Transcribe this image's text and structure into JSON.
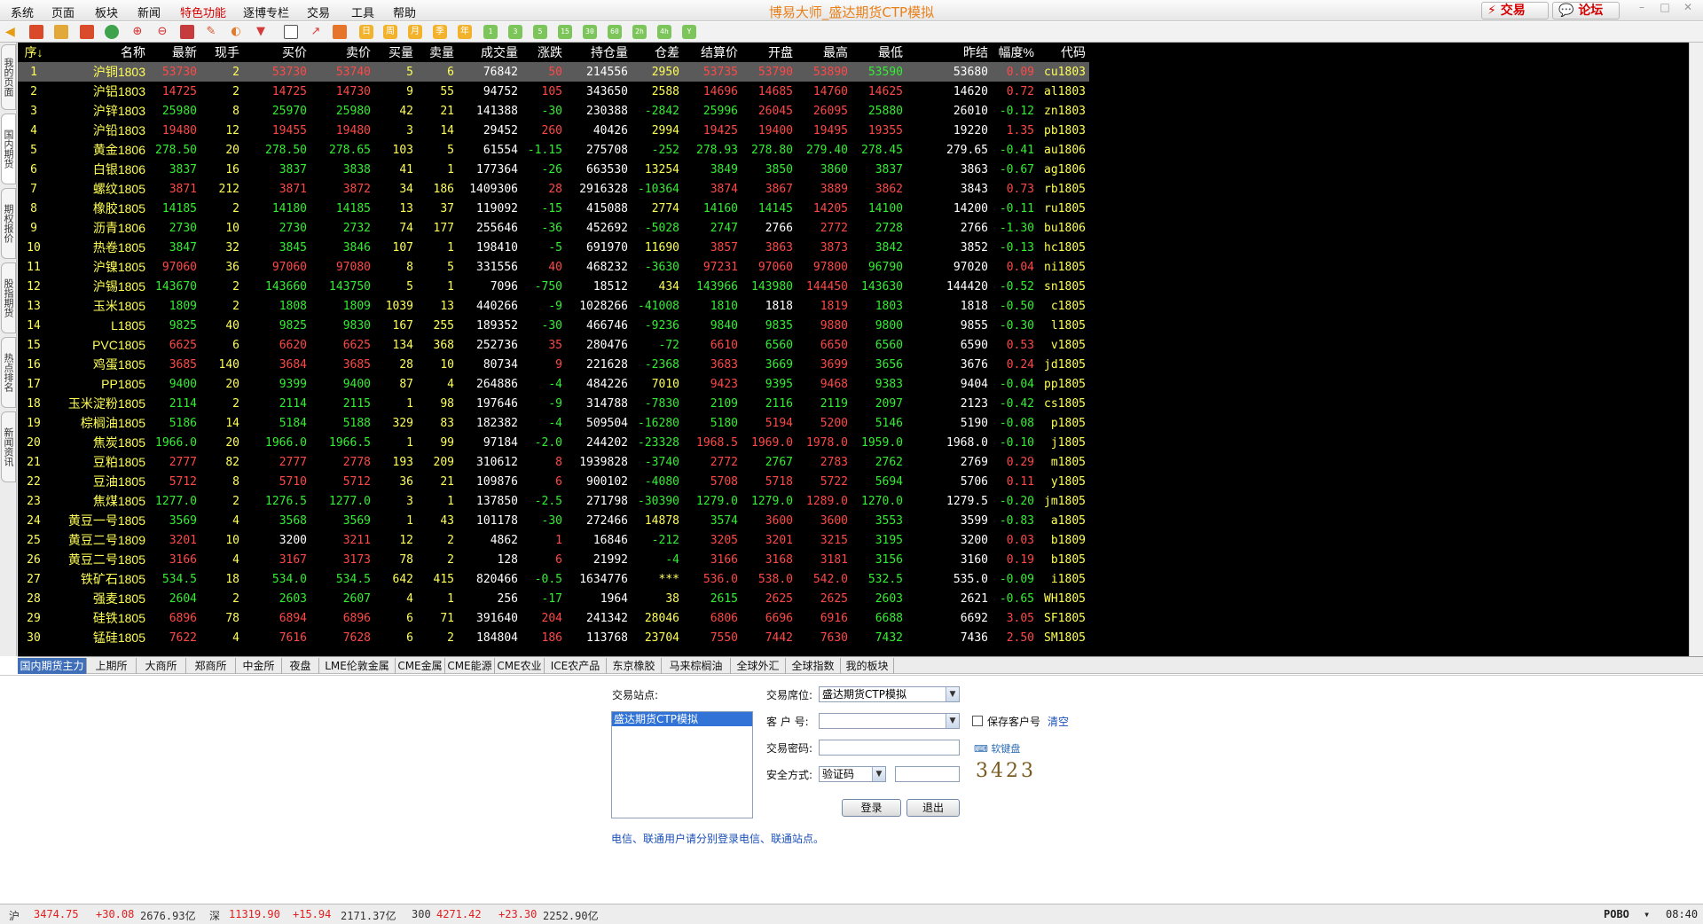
{
  "menu": [
    "系统",
    "页面",
    "板块",
    "新闻",
    "特色功能",
    "逐博专栏",
    "交易",
    "工具",
    "帮助"
  ],
  "app_title": "博易大师_盛达期货CTP模拟",
  "header_buttons": {
    "trade": "交易",
    "forum": "论坛"
  },
  "toolbar": {
    "period_labels": [
      "日",
      "周",
      "月",
      "季",
      "年"
    ],
    "minute_labels": [
      "1",
      "3",
      "5",
      "15",
      "30",
      "60",
      "2h",
      "4h"
    ]
  },
  "left_tabs": [
    "我的页面",
    "国内期货",
    "期权报价",
    "股指期货",
    "热点排名",
    "新闻资讯"
  ],
  "table": {
    "columns": [
      "序↓",
      "名称",
      "最新",
      "现手",
      "买价",
      "卖价",
      "买量",
      "卖量",
      "成交量",
      "涨跌",
      "持仓量",
      "仓差",
      "结算价",
      "开盘",
      "最高",
      "最低",
      "昨结",
      "幅度%",
      "代码"
    ],
    "rows": [
      [
        "1",
        "沪铜1803",
        "53730",
        "2",
        "53730",
        "53740",
        "5",
        "6",
        "76842",
        "50",
        "214556",
        "2950",
        "53735",
        "53790",
        "53890",
        "53590",
        "53680",
        "0.09",
        "cu1803"
      ],
      [
        "2",
        "沪铝1803",
        "14725",
        "2",
        "14725",
        "14730",
        "9",
        "55",
        "94752",
        "105",
        "343650",
        "2588",
        "14696",
        "14685",
        "14760",
        "14625",
        "14620",
        "0.72",
        "al1803"
      ],
      [
        "3",
        "沪锌1803",
        "25980",
        "8",
        "25970",
        "25980",
        "42",
        "21",
        "141388",
        "-30",
        "230388",
        "-2842",
        "25996",
        "26045",
        "26095",
        "25880",
        "26010",
        "-0.12",
        "zn1803"
      ],
      [
        "4",
        "沪铅1803",
        "19480",
        "12",
        "19455",
        "19480",
        "3",
        "14",
        "29452",
        "260",
        "40426",
        "2994",
        "19425",
        "19400",
        "19495",
        "19355",
        "19220",
        "1.35",
        "pb1803"
      ],
      [
        "5",
        "黄金1806",
        "278.50",
        "20",
        "278.50",
        "278.65",
        "103",
        "5",
        "61554",
        "-1.15",
        "275708",
        "-252",
        "278.93",
        "278.80",
        "279.40",
        "278.45",
        "279.65",
        "-0.41",
        "au1806"
      ],
      [
        "6",
        "白银1806",
        "3837",
        "16",
        "3837",
        "3838",
        "41",
        "1",
        "177364",
        "-26",
        "663530",
        "13254",
        "3849",
        "3850",
        "3860",
        "3837",
        "3863",
        "-0.67",
        "ag1806"
      ],
      [
        "7",
        "螺纹1805",
        "3871",
        "212",
        "3871",
        "3872",
        "34",
        "186",
        "1409306",
        "28",
        "2916328",
        "-10364",
        "3874",
        "3867",
        "3889",
        "3862",
        "3843",
        "0.73",
        "rb1805"
      ],
      [
        "8",
        "橡胶1805",
        "14185",
        "2",
        "14180",
        "14185",
        "13",
        "37",
        "119092",
        "-15",
        "415088",
        "2774",
        "14160",
        "14145",
        "14205",
        "14100",
        "14200",
        "-0.11",
        "ru1805"
      ],
      [
        "9",
        "沥青1806",
        "2730",
        "10",
        "2730",
        "2732",
        "74",
        "177",
        "255646",
        "-36",
        "452692",
        "-5028",
        "2747",
        "2766",
        "2772",
        "2728",
        "2766",
        "-1.30",
        "bu1806"
      ],
      [
        "10",
        "热卷1805",
        "3847",
        "32",
        "3845",
        "3846",
        "107",
        "1",
        "198410",
        "-5",
        "691970",
        "11690",
        "3857",
        "3863",
        "3873",
        "3842",
        "3852",
        "-0.13",
        "hc1805"
      ],
      [
        "11",
        "沪镍1805",
        "97060",
        "36",
        "97060",
        "97080",
        "8",
        "5",
        "331556",
        "40",
        "468232",
        "-3630",
        "97231",
        "97060",
        "97800",
        "96790",
        "97020",
        "0.04",
        "ni1805"
      ],
      [
        "12",
        "沪锡1805",
        "143670",
        "2",
        "143660",
        "143750",
        "5",
        "1",
        "7096",
        "-750",
        "18512",
        "434",
        "143966",
        "143980",
        "144450",
        "143630",
        "144420",
        "-0.52",
        "sn1805"
      ],
      [
        "13",
        "玉米1805",
        "1809",
        "2",
        "1808",
        "1809",
        "1039",
        "13",
        "440266",
        "-9",
        "1028266",
        "-41008",
        "1810",
        "1818",
        "1819",
        "1803",
        "1818",
        "-0.50",
        "c1805"
      ],
      [
        "14",
        "L1805",
        "9825",
        "40",
        "9825",
        "9830",
        "167",
        "255",
        "189352",
        "-30",
        "466746",
        "-9236",
        "9840",
        "9835",
        "9880",
        "9800",
        "9855",
        "-0.30",
        "l1805"
      ],
      [
        "15",
        "PVC1805",
        "6625",
        "6",
        "6620",
        "6625",
        "134",
        "368",
        "252736",
        "35",
        "280476",
        "-72",
        "6610",
        "6560",
        "6650",
        "6560",
        "6590",
        "0.53",
        "v1805"
      ],
      [
        "16",
        "鸡蛋1805",
        "3685",
        "140",
        "3684",
        "3685",
        "28",
        "10",
        "80734",
        "9",
        "221628",
        "-2368",
        "3683",
        "3669",
        "3699",
        "3656",
        "3676",
        "0.24",
        "jd1805"
      ],
      [
        "17",
        "PP1805",
        "9400",
        "20",
        "9399",
        "9400",
        "87",
        "4",
        "264886",
        "-4",
        "484226",
        "7010",
        "9423",
        "9395",
        "9468",
        "9383",
        "9404",
        "-0.04",
        "pp1805"
      ],
      [
        "18",
        "玉米淀粉1805",
        "2114",
        "2",
        "2114",
        "2115",
        "1",
        "98",
        "197646",
        "-9",
        "314788",
        "-7830",
        "2109",
        "2116",
        "2119",
        "2097",
        "2123",
        "-0.42",
        "cs1805"
      ],
      [
        "19",
        "棕榈油1805",
        "5186",
        "14",
        "5184",
        "5188",
        "329",
        "83",
        "182382",
        "-4",
        "509504",
        "-16280",
        "5180",
        "5194",
        "5200",
        "5146",
        "5190",
        "-0.08",
        "p1805"
      ],
      [
        "20",
        "焦炭1805",
        "1966.0",
        "20",
        "1966.0",
        "1966.5",
        "1",
        "99",
        "97184",
        "-2.0",
        "244202",
        "-23328",
        "1968.5",
        "1969.0",
        "1978.0",
        "1959.0",
        "1968.0",
        "-0.10",
        "j1805"
      ],
      [
        "21",
        "豆粕1805",
        "2777",
        "82",
        "2777",
        "2778",
        "193",
        "209",
        "310612",
        "8",
        "1939828",
        "-3740",
        "2772",
        "2767",
        "2783",
        "2762",
        "2769",
        "0.29",
        "m1805"
      ],
      [
        "22",
        "豆油1805",
        "5712",
        "8",
        "5710",
        "5712",
        "36",
        "21",
        "109876",
        "6",
        "900102",
        "-4080",
        "5708",
        "5718",
        "5722",
        "5694",
        "5706",
        "0.11",
        "y1805"
      ],
      [
        "23",
        "焦煤1805",
        "1277.0",
        "2",
        "1276.5",
        "1277.0",
        "3",
        "1",
        "137850",
        "-2.5",
        "271798",
        "-30390",
        "1279.0",
        "1279.0",
        "1289.0",
        "1270.0",
        "1279.5",
        "-0.20",
        "jm1805"
      ],
      [
        "24",
        "黄豆一号1805",
        "3569",
        "4",
        "3568",
        "3569",
        "1",
        "43",
        "101178",
        "-30",
        "272466",
        "14878",
        "3574",
        "3600",
        "3600",
        "3553",
        "3599",
        "-0.83",
        "a1805"
      ],
      [
        "25",
        "黄豆二号1809",
        "3201",
        "10",
        "3200",
        "3211",
        "12",
        "2",
        "4862",
        "1",
        "16846",
        "-212",
        "3205",
        "3201",
        "3215",
        "3195",
        "3200",
        "0.03",
        "b1809"
      ],
      [
        "26",
        "黄豆二号1805",
        "3166",
        "4",
        "3167",
        "3173",
        "78",
        "2",
        "128",
        "6",
        "21992",
        "-4",
        "3166",
        "3168",
        "3181",
        "3156",
        "3160",
        "0.19",
        "b1805"
      ],
      [
        "27",
        "铁矿石1805",
        "534.5",
        "18",
        "534.0",
        "534.5",
        "642",
        "415",
        "820466",
        "-0.5",
        "1634776",
        "***",
        "536.0",
        "538.0",
        "542.0",
        "532.5",
        "535.0",
        "-0.09",
        "i1805"
      ],
      [
        "28",
        "强麦1805",
        "2604",
        "2",
        "2603",
        "2607",
        "4",
        "1",
        "256",
        "-17",
        "1964",
        "38",
        "2615",
        "2625",
        "2625",
        "2603",
        "2621",
        "-0.65",
        "WH1805"
      ],
      [
        "29",
        "硅铁1805",
        "6896",
        "78",
        "6894",
        "6896",
        "6",
        "71",
        "391640",
        "204",
        "241342",
        "28046",
        "6806",
        "6696",
        "6916",
        "6688",
        "6692",
        "3.05",
        "SF1805"
      ],
      [
        "30",
        "锰硅1805",
        "7622",
        "4",
        "7616",
        "7628",
        "6",
        "2",
        "184804",
        "186",
        "113768",
        "23704",
        "7550",
        "7442",
        "7630",
        "7432",
        "7436",
        "2.50",
        "SM1805"
      ]
    ]
  },
  "exchange_tabs": [
    "国内期货主力",
    "上期所",
    "大商所",
    "郑商所",
    "中金所",
    "夜盘",
    "LME伦敦金属",
    "CME金属",
    "CME能源",
    "CME农业",
    "ICE农产品",
    "东京橡胶",
    "马来棕榈油",
    "全球外汇",
    "全球指数",
    "我的板块"
  ],
  "login": {
    "station_label": "交易站点:",
    "station_item": "盛达期货CTP模拟",
    "seat_label": "交易席位:",
    "seat_value": "盛达期货CTP模拟",
    "client_label": "客 户 号:",
    "save_client": "保存客户号",
    "clear": "清空",
    "password_label": "交易密码:",
    "soft_keyboard": "软键盘",
    "security_label": "安全方式:",
    "security_value": "验证码",
    "captcha": "3423",
    "login_btn": "登录",
    "exit_btn": "退出",
    "note": "电信、联通用户请分别登录电信、联通站点。"
  },
  "status": {
    "sh_label": "沪",
    "sh_value": "3474.75",
    "sh_change": "+30.08",
    "sh_amount": "2676.93亿",
    "sz_label": "深",
    "sz_value": "11319.90",
    "sz_change": "+15.94",
    "sz_amount": "2171.37亿",
    "c300_label": "300",
    "c300_value": "4271.42",
    "c300_change": "+23.30",
    "c300_amount": "2252.90亿",
    "brand": "POBO",
    "time": "08:40"
  },
  "colors": {
    "up": "#ff4848",
    "down": "#33ee33",
    "flat": "#ffffff",
    "name": "#ffff55",
    "tab_active": "#3f6fb9"
  }
}
